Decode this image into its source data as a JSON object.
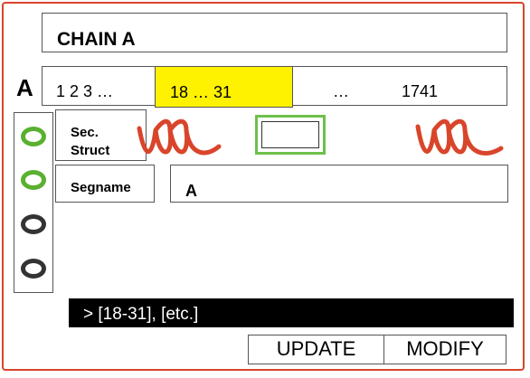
{
  "chain": {
    "title": "CHAIN A",
    "letter": "A"
  },
  "sequence": {
    "start": "1 2 3 …",
    "highlighted_range": "18 … 31",
    "ellipsis": "…",
    "end": "1741"
  },
  "tracks": [
    {
      "label_line1": "Sec.",
      "label_line2": "Struct",
      "visible": true
    },
    {
      "label": "Segname",
      "value": "A",
      "visible": true
    },
    {
      "visible": false
    },
    {
      "visible": false
    }
  ],
  "command": {
    "text": "> [18-31], [etc.]"
  },
  "buttons": {
    "update": "UPDATE",
    "modify": "MODIFY"
  },
  "colors": {
    "frame": "#d9452b",
    "highlight": "#fff200",
    "toggle_on": "#5ab030",
    "helix": "#d9452b",
    "strand_box": "#6cc04a",
    "command_bg": "#000000"
  }
}
